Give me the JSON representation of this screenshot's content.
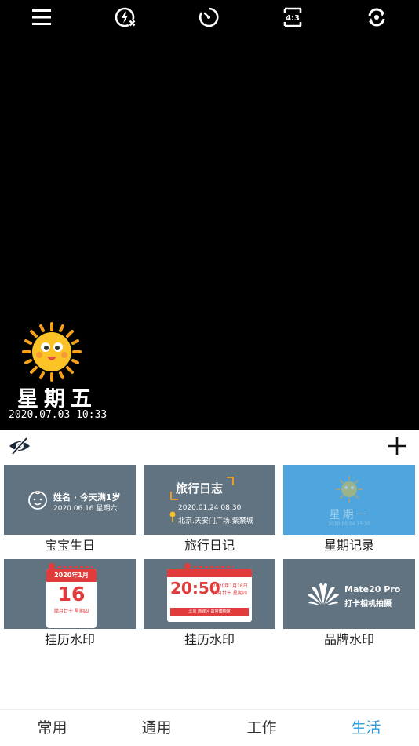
{
  "watermark": {
    "day": "星期五",
    "datetime": "2020.07.03 10:33"
  },
  "templates": [
    {
      "label": "宝宝生日",
      "line1": "姓名 · 今天满1岁",
      "line2": "2020.06.16 星期六"
    },
    {
      "label": "旅行日记",
      "title": "旅行日志",
      "line1": "2020.01.24  08:30",
      "line2": "北京.天安门广场.紫禁城"
    },
    {
      "label": "星期记录",
      "day": "星期一",
      "line2": "2020.05.04 15:30"
    },
    {
      "label": "挂历水印",
      "month": "2020年1月",
      "date": "16",
      "line2": "腊月廿十  星期四"
    },
    {
      "label": "挂历水印",
      "time": "20:50",
      "d1": "2020年1月16日",
      "d2": "腊月廿十 星期四",
      "line2": "北京 西城区 故宫博物馆"
    },
    {
      "label": "品牌水印",
      "line1": "Mate20 Pro",
      "line2": "打卡相机拍摄"
    }
  ],
  "tabs": [
    "常用",
    "通用",
    "工作",
    "生活"
  ],
  "active_tab": "生活",
  "colors": {
    "accent": "#2a9de0",
    "thumb_bg": "#617380",
    "thumb_blue": "#4fa6de",
    "calendar_red": "#e23b3b"
  },
  "icons": {
    "menu": "menu-icon",
    "flash": "flash-off-icon",
    "timer": "timer-icon",
    "ratio": "aspect-ratio-icon",
    "switch": "switch-camera-icon",
    "eye": "hide-eye-icon",
    "plus": "plus-icon"
  },
  "ratio_label": "4:3"
}
